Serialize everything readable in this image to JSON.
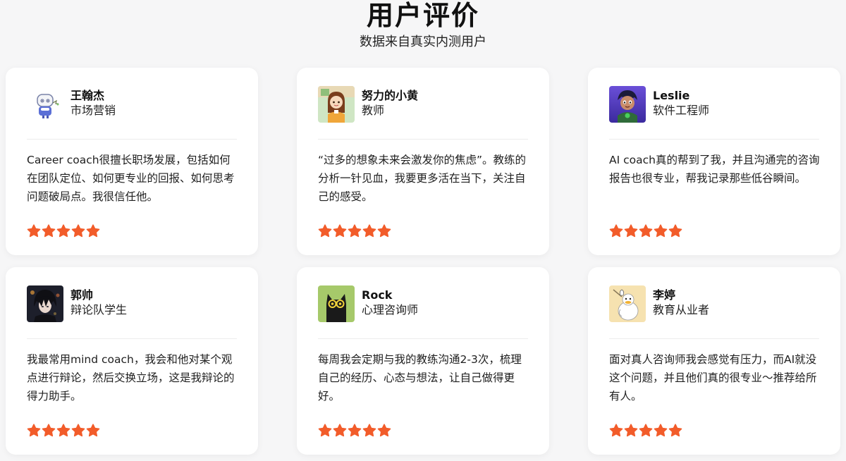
{
  "header": {
    "title": "用户评价",
    "subtitle": "数据来自真实内测用户"
  },
  "colors": {
    "star": "#f25c2a",
    "card_bg": "#ffffff",
    "page_bg": "#f6f6f7"
  },
  "reviews": [
    {
      "name": "王翰杰",
      "role": "市场营销",
      "avatar_icon": "robot-avatar-icon",
      "text": "Career coach很擅长职场发展，包括如何在团队定位、如何更专业的回报、如何思考问题破局点。我很信任他。",
      "rating": 5
    },
    {
      "name": "努力的小黄",
      "role": "教师",
      "avatar_icon": "cartoon-girl-avatar-icon",
      "text": "“过多的想象未来会激发你的焦虑”。教练的分析一针见血，我要更多活在当下，关注自己的感受。",
      "rating": 5
    },
    {
      "name": "Leslie",
      "role": "软件工程师",
      "avatar_icon": "3d-character-avatar-icon",
      "text": "AI coach真的帮到了我，并且沟通完的咨询报告也很专业，帮我记录那些低谷瞬间。",
      "rating": 5
    },
    {
      "name": "郭帅",
      "role": "辩论队学生",
      "avatar_icon": "anime-boy-avatar-icon",
      "text": "我最常用mind coach，我会和他对某个观点进行辩论，然后交换立场，这是我辩论的得力助手。",
      "rating": 5
    },
    {
      "name": "Rock",
      "role": "心理咨询师",
      "avatar_icon": "black-cat-avatar-icon",
      "text": "每周我会定期与我的教练沟通2-3次，梳理自己的经历、心态与想法，让自己做得更好。",
      "rating": 5
    },
    {
      "name": "李婷",
      "role": "教育从业者",
      "avatar_icon": "duck-avatar-icon",
      "text": "面对真人咨询师我会感觉有压力，而AI就没这个问题，并且他们真的很专业～推荐给所有人。",
      "rating": 5
    }
  ]
}
